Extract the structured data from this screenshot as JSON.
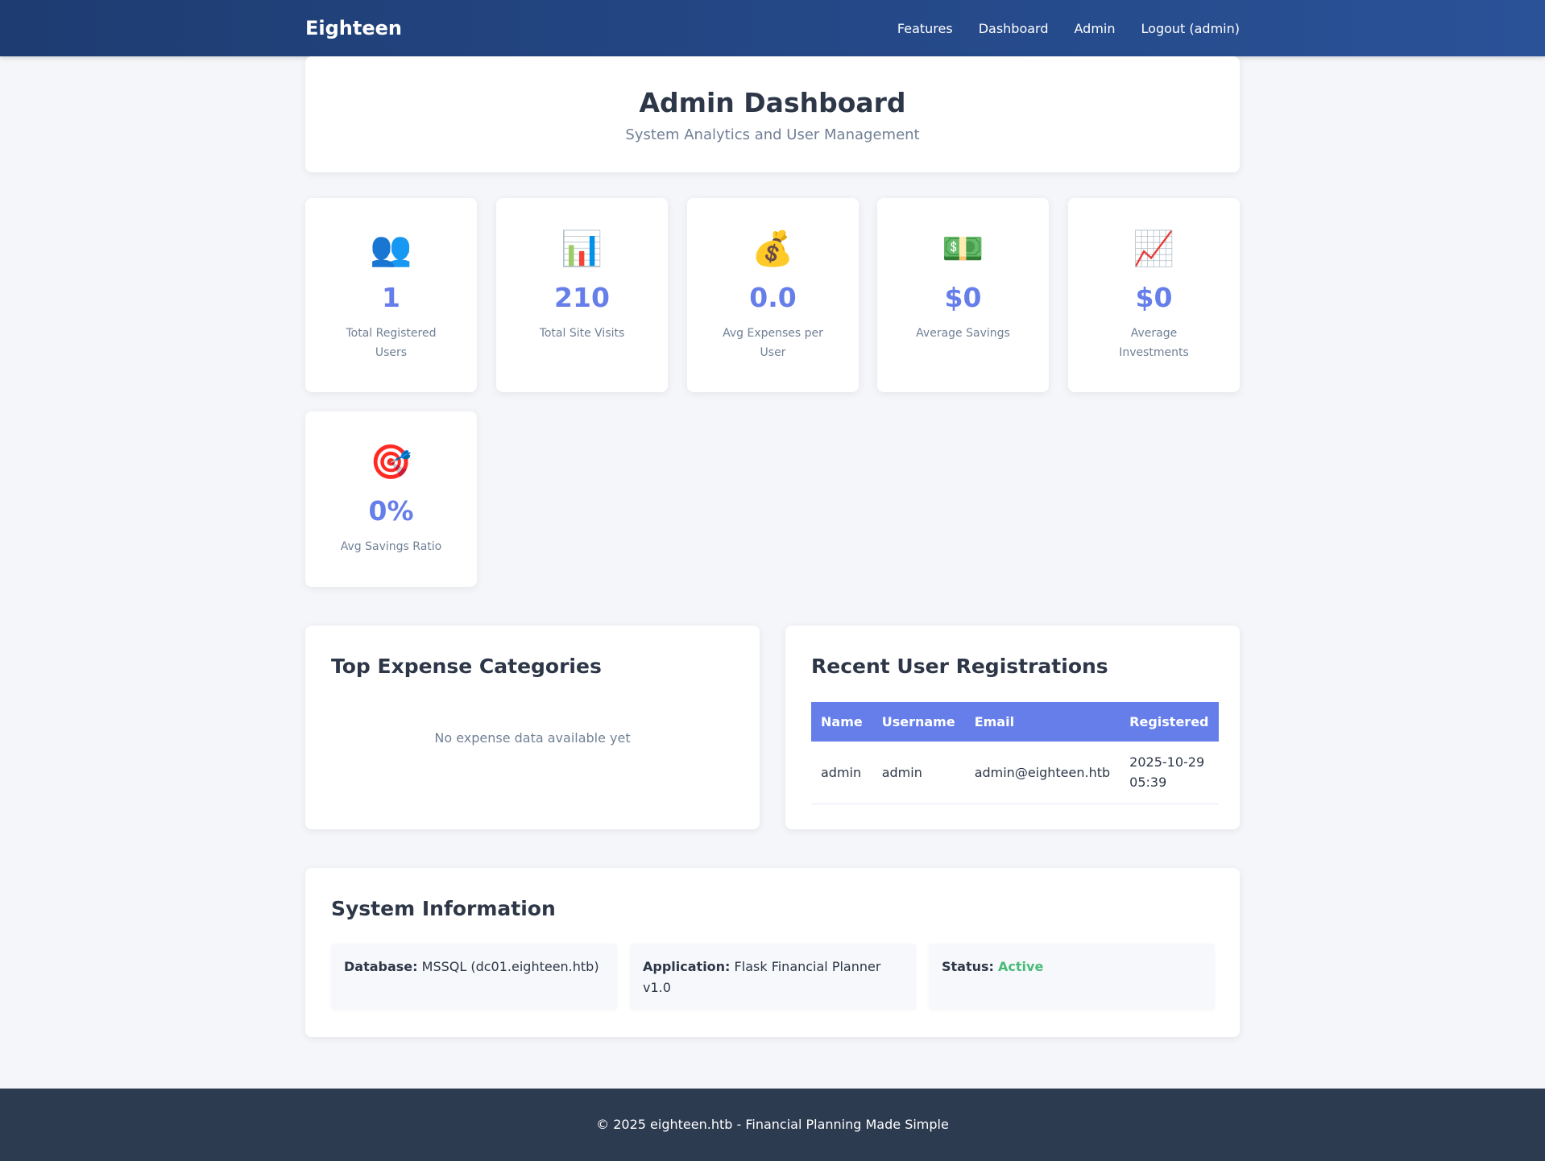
{
  "navbar": {
    "brand": "Eighteen",
    "links": [
      "Features",
      "Dashboard",
      "Admin",
      "Logout (admin)"
    ]
  },
  "header": {
    "title": "Admin Dashboard",
    "subtitle": "System Analytics and User Management"
  },
  "stats": [
    {
      "icon": "👥",
      "icon_name": "users-icon",
      "value": "1",
      "label": "Total Registered Users"
    },
    {
      "icon": "📊",
      "icon_name": "bar-chart-icon",
      "value": "210",
      "label": "Total Site Visits"
    },
    {
      "icon": "💰",
      "icon_name": "money-bag-icon",
      "value": "0.0",
      "label": "Avg Expenses per User"
    },
    {
      "icon": "💵",
      "icon_name": "dollar-bill-icon",
      "value": "$0",
      "label": "Average Savings"
    },
    {
      "icon": "📈",
      "icon_name": "trend-up-icon",
      "value": "$0",
      "label": "Average Investments"
    },
    {
      "icon": "🎯",
      "icon_name": "target-icon",
      "value": "0%",
      "label": "Avg Savings Ratio"
    }
  ],
  "expenses": {
    "title": "Top Expense Categories",
    "empty_message": "No expense data available yet"
  },
  "registrations": {
    "title": "Recent User Registrations",
    "columns": [
      "Name",
      "Username",
      "Email",
      "Registered"
    ],
    "rows": [
      {
        "name": "admin",
        "username": "admin",
        "email": "admin@eighteen.htb",
        "registered": "2025-10-29 05:39"
      }
    ]
  },
  "system": {
    "title": "System Information",
    "database_label": "Database:",
    "database_value": "MSSQL (dc01.eighteen.htb)",
    "application_label": "Application:",
    "application_value": "Flask Financial Planner v1.0",
    "status_label": "Status:",
    "status_value": "Active"
  },
  "footer": {
    "text": "© 2025 eighteen.htb - Financial Planning Made Simple"
  },
  "colors": {
    "accent": "#667eea",
    "nav_start": "#1e3c72",
    "nav_end": "#2a5298",
    "status_active": "#48bb78",
    "footer_bg": "#2d3b50"
  }
}
